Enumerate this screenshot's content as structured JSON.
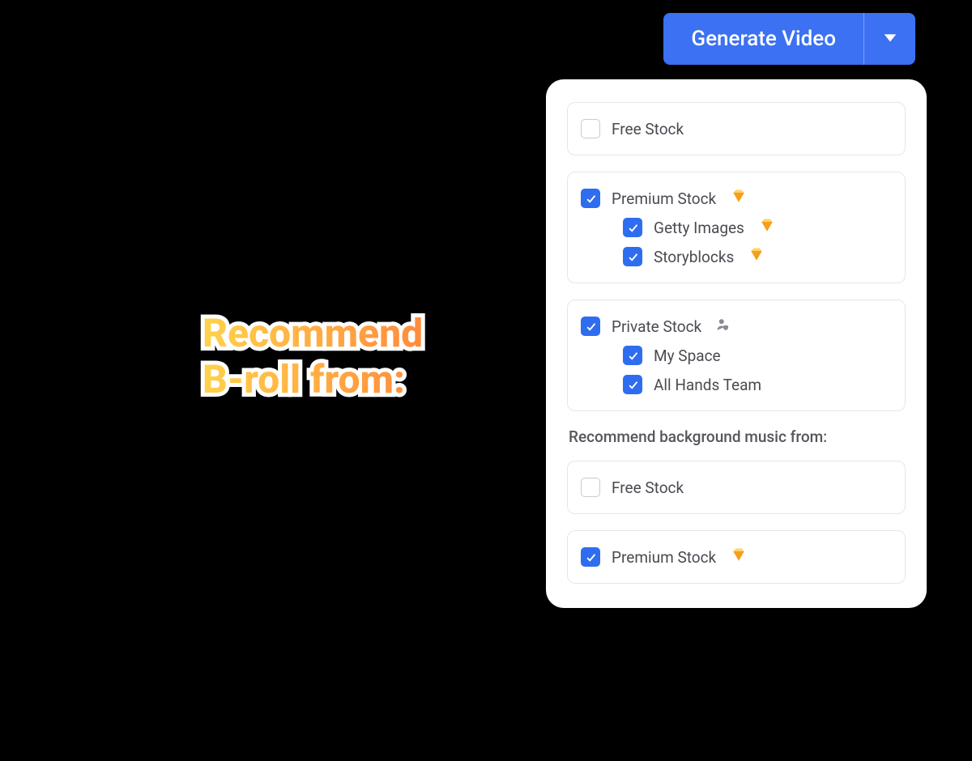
{
  "headline": {
    "line1": "Recommend",
    "line2": "B-roll from:"
  },
  "generate_button": {
    "label": "Generate Video"
  },
  "panel": {
    "broll": {
      "free_stock": {
        "label": "Free Stock",
        "checked": false
      },
      "premium_stock": {
        "label": "Premium Stock",
        "checked": true,
        "premium_icon": true,
        "children": [
          {
            "label": "Getty Images",
            "checked": true,
            "premium_icon": true
          },
          {
            "label": "Storyblocks",
            "checked": true,
            "premium_icon": true
          }
        ]
      },
      "private_stock": {
        "label": "Private Stock",
        "checked": true,
        "private_icon": true,
        "children": [
          {
            "label": "My Space",
            "checked": true
          },
          {
            "label": "All Hands Team",
            "checked": true
          }
        ]
      }
    },
    "music_section_title": "Recommend background music from:",
    "music": {
      "free_stock": {
        "label": "Free Stock",
        "checked": false
      },
      "premium_stock": {
        "label": "Premium Stock",
        "checked": true,
        "premium_icon": true
      }
    }
  },
  "colors": {
    "accent": "#3b71f2"
  }
}
